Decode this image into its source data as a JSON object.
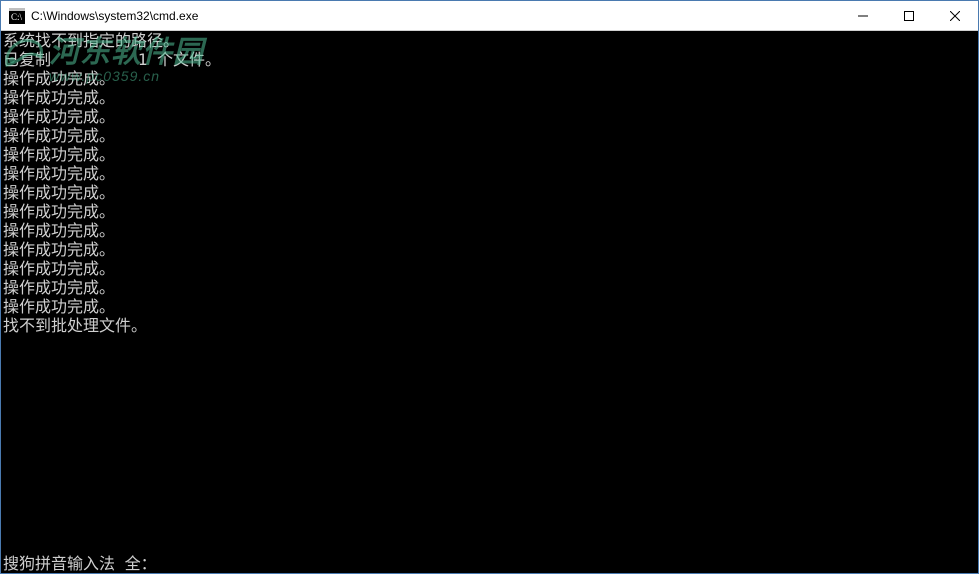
{
  "window": {
    "title": "C:\\Windows\\system32\\cmd.exe",
    "icon": "cmd-icon",
    "controls": {
      "minimize": "minimize",
      "maximize": "maximize",
      "close": "close"
    }
  },
  "console": {
    "lines": [
      "系统找不到指定的路径。",
      "已复制         1 个文件。",
      "操作成功完成。",
      "操作成功完成。",
      "操作成功完成。",
      "操作成功完成。",
      "操作成功完成。",
      "操作成功完成。",
      "操作成功完成。",
      "操作成功完成。",
      "操作成功完成。",
      "操作成功完成。",
      "操作成功完成。",
      "操作成功完成。",
      "操作成功完成。",
      "找不到批处理文件。"
    ],
    "bottom": "搜狗拼音输入法 全："
  },
  "watermark": {
    "brand": "河东软件园",
    "url": "www.pc0359.cn"
  }
}
